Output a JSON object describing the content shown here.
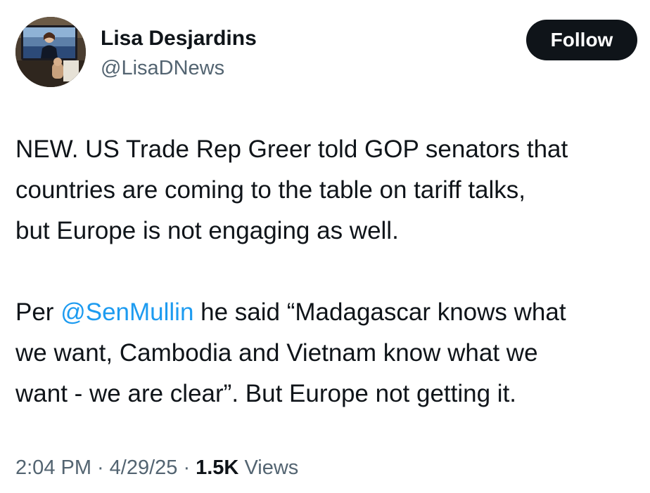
{
  "author": {
    "display_name": "Lisa Desjardins",
    "handle": "@LisaDNews",
    "avatar_icon": "profile-photo"
  },
  "follow_button": {
    "label": "Follow"
  },
  "tweet": {
    "line1": "NEW. US Trade Rep Greer told GOP senators that",
    "line2": "countries are coming to the table on tariff talks,",
    "line3": "but Europe is not engaging as well.",
    "line4_prefix": "Per ",
    "mention": "@SenMullin",
    "line4_suffix": " he said “Madagascar knows what",
    "line5": "we want, Cambodia and Vietnam know what we",
    "line6": "want - we are clear”.  But Europe not getting it."
  },
  "meta": {
    "time": "2:04 PM",
    "date": "4/29/25",
    "views_count": "1.5K",
    "views_label": "Views",
    "separator": "·"
  },
  "colors": {
    "text": "#0f1419",
    "secondary": "#536471",
    "link": "#1d9bf0",
    "button_bg": "#0f1419",
    "button_text": "#ffffff"
  }
}
